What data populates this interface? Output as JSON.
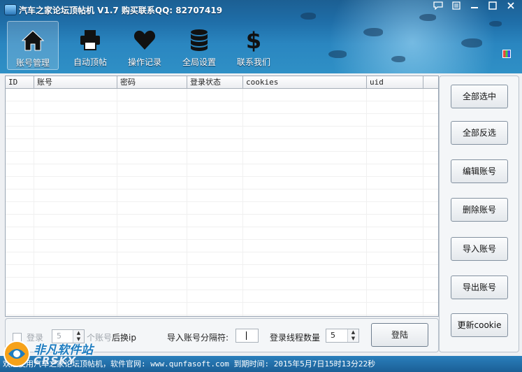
{
  "window": {
    "title": "汽车之家论坛顶帖机 V1.7 购买联系QQ: 82707419",
    "controls": [
      "chat-icon",
      "menu-icon",
      "minimize-icon",
      "maximize-icon",
      "close-icon"
    ]
  },
  "nav": {
    "items": [
      {
        "label": "账号管理",
        "icon": "home-icon",
        "active": true
      },
      {
        "label": "自动顶帖",
        "icon": "printer-icon",
        "active": false
      },
      {
        "label": "操作记录",
        "icon": "heart-icon",
        "active": false
      },
      {
        "label": "全局设置",
        "icon": "database-icon",
        "active": false
      },
      {
        "label": "联系我们",
        "icon": "dollar-icon",
        "active": false
      }
    ]
  },
  "table": {
    "columns": [
      "ID",
      "账号",
      "密码",
      "登录状态",
      "cookies",
      "uid"
    ],
    "rows": []
  },
  "side_buttons": {
    "select_all": "全部选中",
    "invert_select": "全部反选",
    "edit_account": "编辑账号",
    "delete_account": "删除账号",
    "import_account": "导入账号",
    "export_account": "导出账号",
    "update_cookie": "更新cookie"
  },
  "bottom": {
    "login_label": "登录",
    "account_count_value": "5",
    "after_change_ip_label": "个账号后换ip",
    "separator_label": "导入账号分隔符:",
    "separator_value": "|",
    "threads_label": "登录线程数量",
    "threads_value": "5",
    "login_button": "登陆"
  },
  "status": {
    "text": "欢迎使用汽车之家论坛顶帖机，软件官网: www.qunfasoft.com  到期时间: 2015年5月7日15时13分22秒"
  },
  "watermark": {
    "cn": "非凡软件站",
    "en": "CRSKY"
  }
}
